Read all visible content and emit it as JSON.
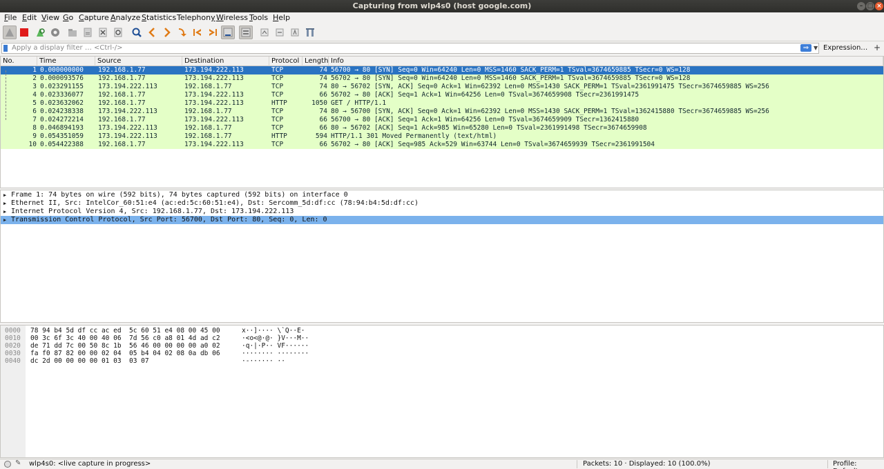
{
  "window": {
    "title": "Capturing from wlp4s0 (host google.com)"
  },
  "menu": [
    {
      "pre": "",
      "u": "F",
      "post": "ile"
    },
    {
      "pre": "",
      "u": "E",
      "post": "dit"
    },
    {
      "pre": "",
      "u": "V",
      "post": "iew"
    },
    {
      "pre": "",
      "u": "G",
      "post": "o"
    },
    {
      "pre": "",
      "u": "C",
      "post": "apture"
    },
    {
      "pre": "",
      "u": "A",
      "post": "nalyze"
    },
    {
      "pre": "",
      "u": "S",
      "post": "tatistics"
    },
    {
      "pre": "Telephon",
      "u": "y",
      "post": ""
    },
    {
      "pre": "",
      "u": "W",
      "post": "ireless"
    },
    {
      "pre": "",
      "u": "T",
      "post": "ools"
    },
    {
      "pre": "",
      "u": "H",
      "post": "elp"
    }
  ],
  "filter": {
    "placeholder": "Apply a display filter … <Ctrl-/>",
    "expression_label": "Expression…",
    "plus_label": "+"
  },
  "columns": [
    "No.",
    "Time",
    "Source",
    "Destination",
    "Protocol",
    "Length",
    "Info"
  ],
  "packets": [
    {
      "no": "1",
      "time": "0.000000000",
      "src": "192.168.1.77",
      "dst": "173.194.222.113",
      "proto": "TCP",
      "len": "74",
      "info": "56700 → 80 [SYN] Seq=0 Win=64240 Len=0 MSS=1460 SACK_PERM=1 TSval=3674659885 TSecr=0 WS=128"
    },
    {
      "no": "2",
      "time": "0.000093576",
      "src": "192.168.1.77",
      "dst": "173.194.222.113",
      "proto": "TCP",
      "len": "74",
      "info": "56702 → 80 [SYN] Seq=0 Win=64240 Len=0 MSS=1460 SACK_PERM=1 TSval=3674659885 TSecr=0 WS=128"
    },
    {
      "no": "3",
      "time": "0.023291155",
      "src": "173.194.222.113",
      "dst": "192.168.1.77",
      "proto": "TCP",
      "len": "74",
      "info": "80 → 56702 [SYN, ACK] Seq=0 Ack=1 Win=62392 Len=0 MSS=1430 SACK_PERM=1 TSval=2361991475 TSecr=3674659885 WS=256"
    },
    {
      "no": "4",
      "time": "0.023336077",
      "src": "192.168.1.77",
      "dst": "173.194.222.113",
      "proto": "TCP",
      "len": "66",
      "info": "56702 → 80 [ACK] Seq=1 Ack=1 Win=64256 Len=0 TSval=3674659908 TSecr=2361991475"
    },
    {
      "no": "5",
      "time": "0.023632062",
      "src": "192.168.1.77",
      "dst": "173.194.222.113",
      "proto": "HTTP",
      "len": "1050",
      "info": "GET / HTTP/1.1"
    },
    {
      "no": "6",
      "time": "0.024238338",
      "src": "173.194.222.113",
      "dst": "192.168.1.77",
      "proto": "TCP",
      "len": "74",
      "info": "80 → 56700 [SYN, ACK] Seq=0 Ack=1 Win=62392 Len=0 MSS=1430 SACK_PERM=1 TSval=1362415880 TSecr=3674659885 WS=256"
    },
    {
      "no": "7",
      "time": "0.024272214",
      "src": "192.168.1.77",
      "dst": "173.194.222.113",
      "proto": "TCP",
      "len": "66",
      "info": "56700 → 80 [ACK] Seq=1 Ack=1 Win=64256 Len=0 TSval=3674659909 TSecr=1362415880"
    },
    {
      "no": "8",
      "time": "0.046894193",
      "src": "173.194.222.113",
      "dst": "192.168.1.77",
      "proto": "TCP",
      "len": "66",
      "info": "80 → 56702 [ACK] Seq=1 Ack=985 Win=65280 Len=0 TSval=2361991498 TSecr=3674659908"
    },
    {
      "no": "9",
      "time": "0.054351059",
      "src": "173.194.222.113",
      "dst": "192.168.1.77",
      "proto": "HTTP",
      "len": "594",
      "info": "HTTP/1.1 301 Moved Permanently  (text/html)"
    },
    {
      "no": "10",
      "time": "0.054422388",
      "src": "192.168.1.77",
      "dst": "173.194.222.113",
      "proto": "TCP",
      "len": "66",
      "info": "56702 → 80 [ACK] Seq=985 Ack=529 Win=63744 Len=0 TSval=3674659939 TSecr=2361991504"
    }
  ],
  "details": [
    "Frame 1: 74 bytes on wire (592 bits), 74 bytes captured (592 bits) on interface 0",
    "Ethernet II, Src: IntelCor_60:51:e4 (ac:ed:5c:60:51:e4), Dst: Sercomm_5d:df:cc (78:94:b4:5d:df:cc)",
    "Internet Protocol Version 4, Src: 192.168.1.77, Dst: 173.194.222.113",
    "Transmission Control Protocol, Src Port: 56700, Dst Port: 80, Seq: 0, Len: 0"
  ],
  "bytes": [
    {
      "offset": "0000",
      "hex": "78 94 b4 5d df cc ac ed  5c 60 51 e4 08 00 45 00",
      "ascii": "x··]···· \\`Q··E·"
    },
    {
      "offset": "0010",
      "hex": "00 3c 6f 3c 40 00 40 06  7d 56 c0 a8 01 4d ad c2",
      "ascii": "·<o<@·@· }V···M··"
    },
    {
      "offset": "0020",
      "hex": "de 71 dd 7c 00 50 8c 1b  56 46 00 00 00 00 a0 02",
      "ascii": "·q·|·P·· VF······"
    },
    {
      "offset": "0030",
      "hex": "fa f0 87 82 00 00 02 04  05 b4 04 02 08 0a db 06",
      "ascii": "········ ········"
    },
    {
      "offset": "0040",
      "hex": "dc 2d 00 00 00 00 01 03  03 07",
      "ascii": "·-······ ··"
    }
  ],
  "status": {
    "capture": "wlp4s0: <live capture in progress>",
    "packets": "Packets: 10 · Displayed: 10 (100.0%)",
    "profile": "Profile: Default"
  },
  "colors": {
    "selected_row": "#2a73c2",
    "tcp_row": "#e4ffc7",
    "selected_detail": "#7bb2ec"
  },
  "icons": {
    "toolbar": [
      "shark-fin-start-icon",
      "stop-icon",
      "restart-icon",
      "capture-options-icon",
      "open-file-icon",
      "save-file-icon",
      "close-file-icon",
      "reload-icon",
      "find-packet-icon",
      "go-back-icon",
      "go-forward-icon",
      "go-to-packet-icon",
      "go-first-icon",
      "go-last-icon",
      "autoscroll-icon",
      "colorize-icon",
      "zoom-in-icon",
      "zoom-out-icon",
      "normal-size-icon",
      "resize-columns-icon"
    ]
  }
}
